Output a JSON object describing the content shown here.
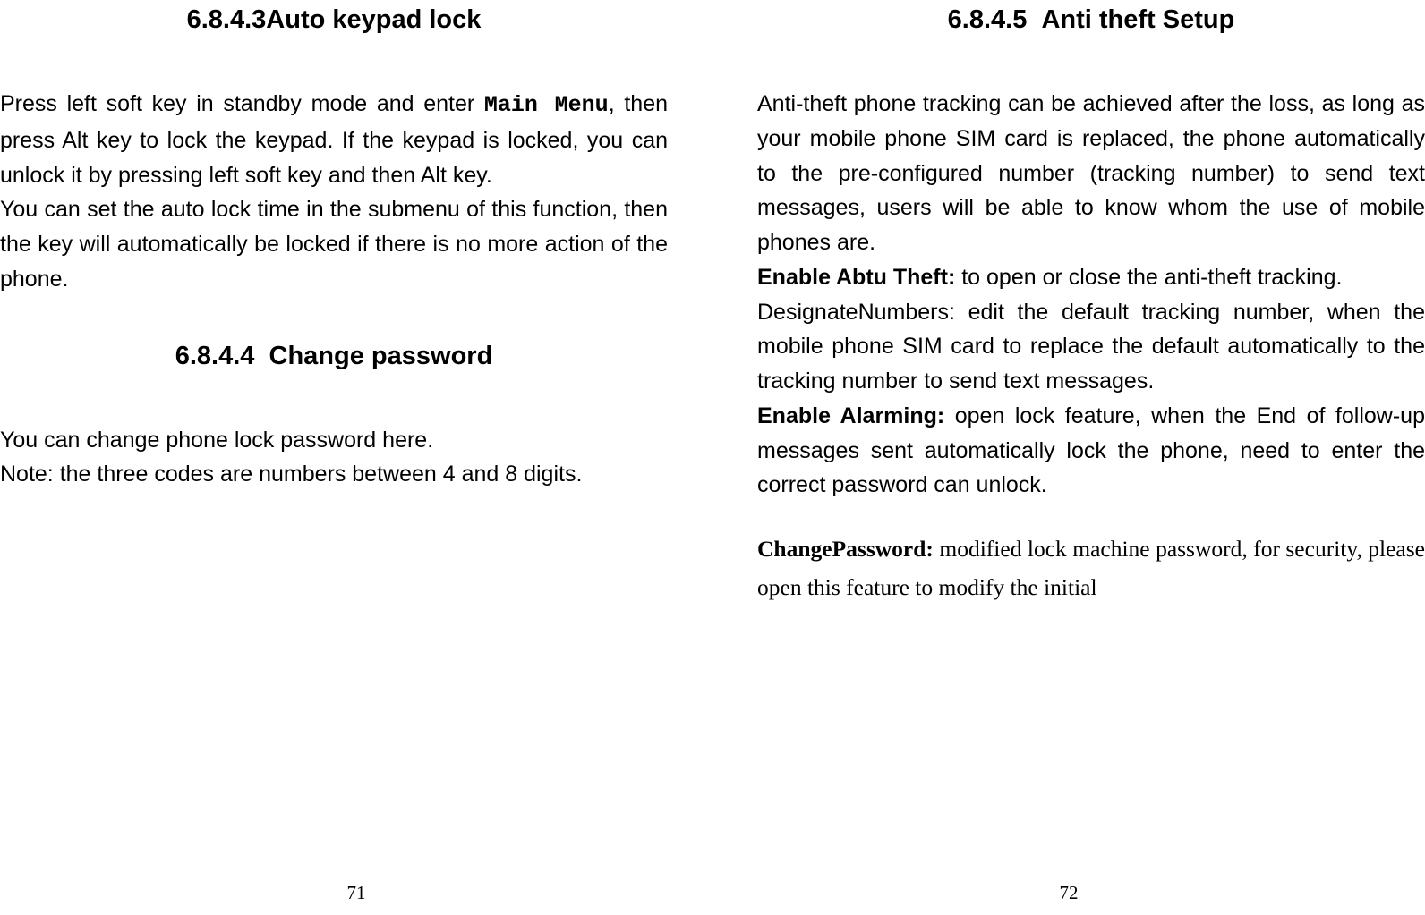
{
  "left": {
    "section1": {
      "number": "6.8.4.3",
      "title": "Auto keypad lock"
    },
    "para1_a": "Press left soft key in standby mode and enter ",
    "para1_mono": "Main Menu",
    "para1_b": ", then press Alt key to lock the keypad. If the keypad is locked, you can unlock it by pressing left soft key and then Alt key.",
    "para2": "You can set the auto lock time in the submenu of this function, then the key will automatically be locked if there is no more action of the phone.",
    "section2": {
      "number": "6.8.4.4",
      "title": "Change password"
    },
    "para3": "You can change phone lock password here.",
    "para4": "Note: the three codes are numbers between 4 and 8 digits.",
    "page_number": "71"
  },
  "right": {
    "section1": {
      "number": "6.8.4.5",
      "title": "Anti theft Setup"
    },
    "para1": "Anti-theft phone tracking can be achieved after the loss, as long as your mobile phone SIM card is replaced, the phone automatically to the pre-configured number (tracking number) to send text messages, users will be able to know whom the use of mobile phones are.",
    "para2_bold": "Enable Abtu Theft:",
    "para2_rest": " to open or close the anti-theft tracking.",
    "para3": "DesignateNumbers: edit the default tracking number, when the mobile phone SIM card to replace the default automatically to the tracking number to send text messages.",
    "para4_bold": "Enable Alarming:",
    "para4_rest": " open lock feature, when the End of follow-up messages sent automatically lock the phone, need to enter the correct password can unlock.",
    "para5_bold": "ChangePassword:",
    "para5_rest": " modified lock machine password, for security, please open this feature to modify the initial",
    "page_number": "72"
  }
}
